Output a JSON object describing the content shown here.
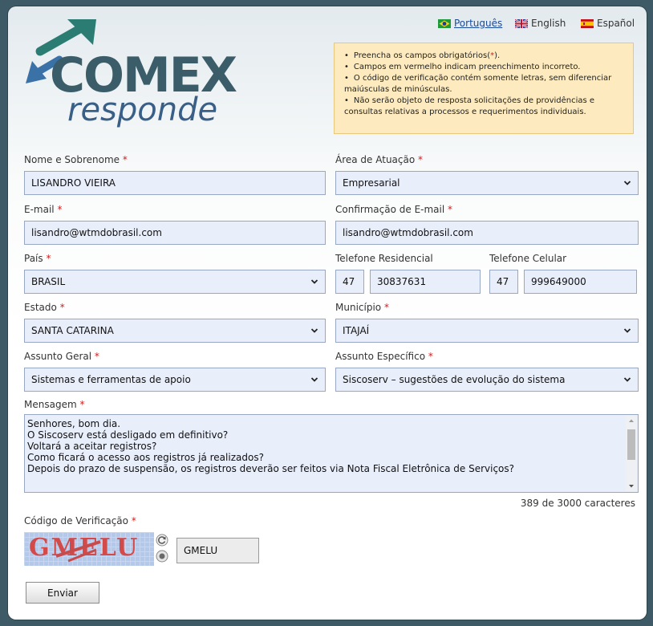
{
  "languages": [
    {
      "label": "Português",
      "active": true
    },
    {
      "label": "English",
      "active": false
    },
    {
      "label": "Español",
      "active": false
    }
  ],
  "logo": {
    "line1": "COMEX",
    "line2": "responde"
  },
  "notice": {
    "item1_before": "Preencha os campos obrigatórios(",
    "item1_mark": "*",
    "item1_after": ").",
    "item2": "Campos em vermelho indicam preenchimento incorreto.",
    "item3": "O código de verificação contém somente letras, sem diferenciar maiúsculas de minúsculas.",
    "item4": "Não serão objeto de resposta solicitações de providências e consultas relativas a processos e requerimentos individuais."
  },
  "required_mark": "*",
  "form": {
    "name_label": "Nome e Sobrenome",
    "name_value": "LISANDRO VIEIRA",
    "area_label": "Área de Atuação",
    "area_value": "Empresarial",
    "email_label": "E-mail",
    "email_value": "lisandro@wtmdobrasil.com",
    "email_confirm_label": "Confirmação de E-mail",
    "email_confirm_value": "lisandro@wtmdobrasil.com",
    "country_label": "País",
    "country_value": "BRASIL",
    "home_phone_label": "Telefone Residencial",
    "home_phone_ddd": "47",
    "home_phone_number": "30837631",
    "cell_phone_label": "Telefone Celular",
    "cell_phone_ddd": "47",
    "cell_phone_number": "999649000",
    "state_label": "Estado",
    "state_value": "SANTA CATARINA",
    "city_label": "Município",
    "city_value": "ITAJAÍ",
    "general_subject_label": "Assunto Geral",
    "general_subject_value": "Sistemas e ferramentas de apoio",
    "specific_subject_label": "Assunto Específico",
    "specific_subject_value": "Siscoserv – sugestões de evolução do sistema",
    "message_label": "Mensagem",
    "message_lines": [
      "Senhores, bom dia.",
      "O Siscoserv está desligado em definitivo?",
      "Voltará a aceitar registros?",
      "Como ficará o acesso aos registros já realizados?",
      "Depois do prazo de suspensão, os registros deverão ser feitos via Nota Fiscal Eletrônica de Serviços?"
    ],
    "char_count": "389 de 3000 caracteres",
    "captcha_label": "Código de Verificação",
    "captcha_image_text": "GMELU",
    "captcha_value": "GMELU",
    "submit_label": "Enviar"
  },
  "colors": {
    "required": "#d21d1d",
    "logo_text": "#3b5c69",
    "logo_arrow_green": "#2b7d74",
    "logo_arrow_blue": "#3a72a8",
    "field_bg": "#e9eefb",
    "notice_bg": "#fdebbf"
  }
}
